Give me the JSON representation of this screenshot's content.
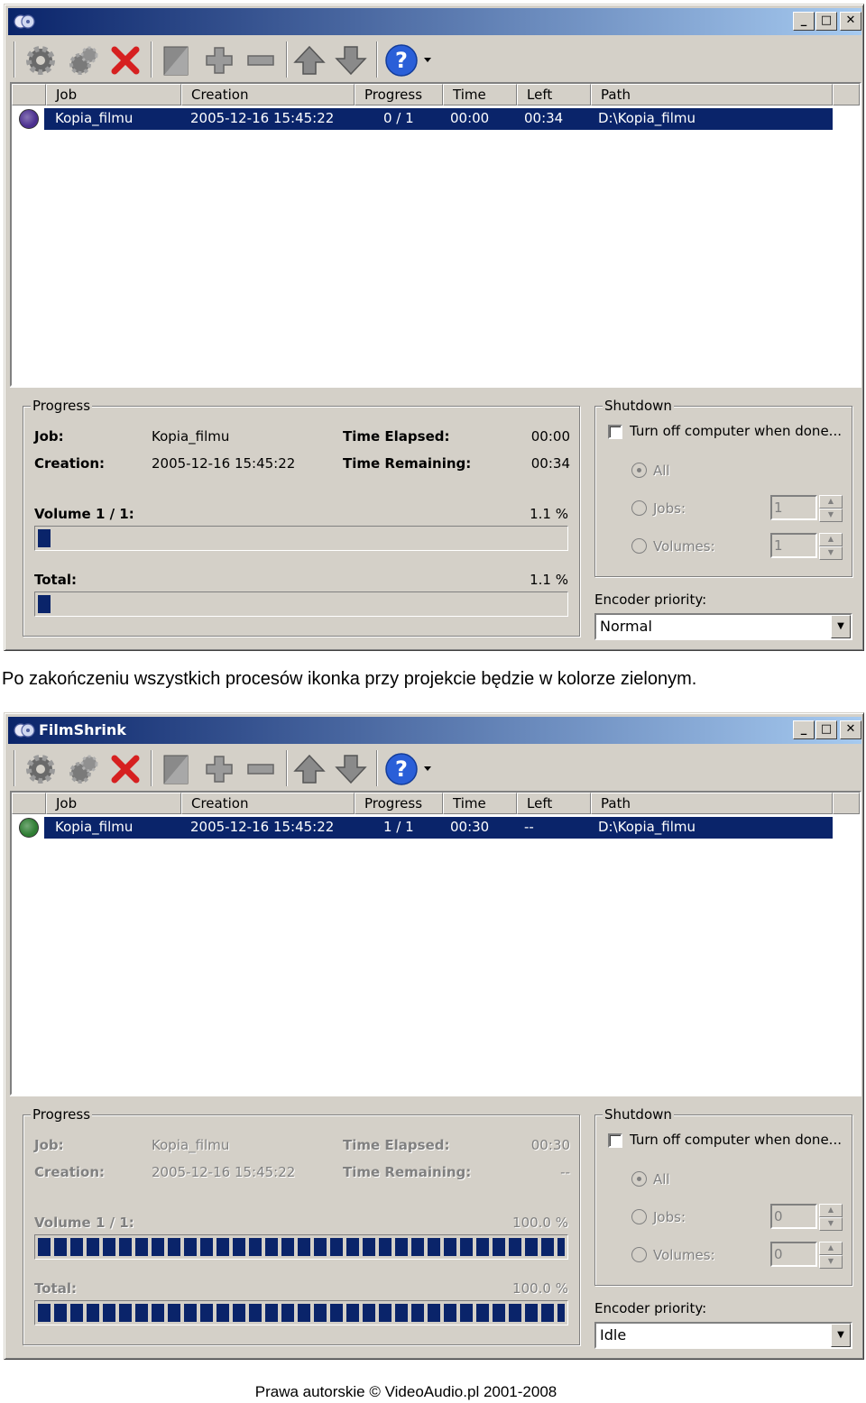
{
  "windows": [
    {
      "title": "",
      "columns": [
        "Job",
        "Creation",
        "Progress",
        "Time",
        "Left",
        "Path"
      ],
      "row": {
        "job": "Kopia_filmu",
        "creation": "2005-12-16 15:45:22",
        "progress": "0 / 1",
        "time": "00:00",
        "left": "00:34",
        "path": "D:\\Kopia_filmu",
        "status_icon": "purple-disc-icon",
        "status_color": "#4b2f8f"
      },
      "progress_group": "Progress",
      "job_label": "Job:",
      "job_value": "Kopia_filmu",
      "creation_label": "Creation:",
      "creation_value": "2005-12-16 15:45:22",
      "elapsed_label": "Time Elapsed:",
      "elapsed_value": "00:00",
      "remaining_label": "Time Remaining:",
      "remaining_value": "00:34",
      "volume_label": "Volume 1 / 1:",
      "volume_percent": "1.1 %",
      "volume_fraction": 0.011,
      "total_label": "Total:",
      "total_percent": "1.1 %",
      "total_fraction": 0.011,
      "shutdown_group": "Shutdown",
      "shutdown_check": "Turn off computer when done...",
      "radio_all": "All",
      "radio_jobs": "Jobs:",
      "radio_volumes": "Volumes:",
      "jobs_value": "1",
      "volumes_value": "1",
      "encoder_label": "Encoder priority:",
      "encoder_value": "Normal",
      "disabled_progress": false
    },
    {
      "title": "FilmShrink",
      "columns": [
        "Job",
        "Creation",
        "Progress",
        "Time",
        "Left",
        "Path"
      ],
      "row": {
        "job": "Kopia_filmu",
        "creation": "2005-12-16 15:45:22",
        "progress": "1 / 1",
        "time": "00:30",
        "left": "--",
        "path": "D:\\Kopia_filmu",
        "status_icon": "green-disc-icon",
        "status_color": "#2e7d32"
      },
      "progress_group": "Progress",
      "job_label": "Job:",
      "job_value": "Kopia_filmu",
      "creation_label": "Creation:",
      "creation_value": "2005-12-16 15:45:22",
      "elapsed_label": "Time Elapsed:",
      "elapsed_value": "00:30",
      "remaining_label": "Time Remaining:",
      "remaining_value": "--",
      "volume_label": "Volume 1 / 1:",
      "volume_percent": "100.0 %",
      "volume_fraction": 1.0,
      "total_label": "Total:",
      "total_percent": "100.0 %",
      "total_fraction": 1.0,
      "shutdown_group": "Shutdown",
      "shutdown_check": "Turn off computer when done...",
      "radio_all": "All",
      "radio_jobs": "Jobs:",
      "radio_volumes": "Volumes:",
      "jobs_value": "0",
      "volumes_value": "0",
      "encoder_label": "Encoder priority:",
      "encoder_value": "Idle",
      "disabled_progress": true
    }
  ],
  "caption": "Po zakończeniu wszystkich procesów ikonka przy projekcie będzie w kolorze zielonym.",
  "footer": "Prawa autorskie © VideoAudio.pl 2001-2008",
  "colors": {
    "selection": "#0a246a",
    "face": "#d4d0c8",
    "title_gradient_start": "#0a246a",
    "title_gradient_end": "#a6caf0"
  }
}
